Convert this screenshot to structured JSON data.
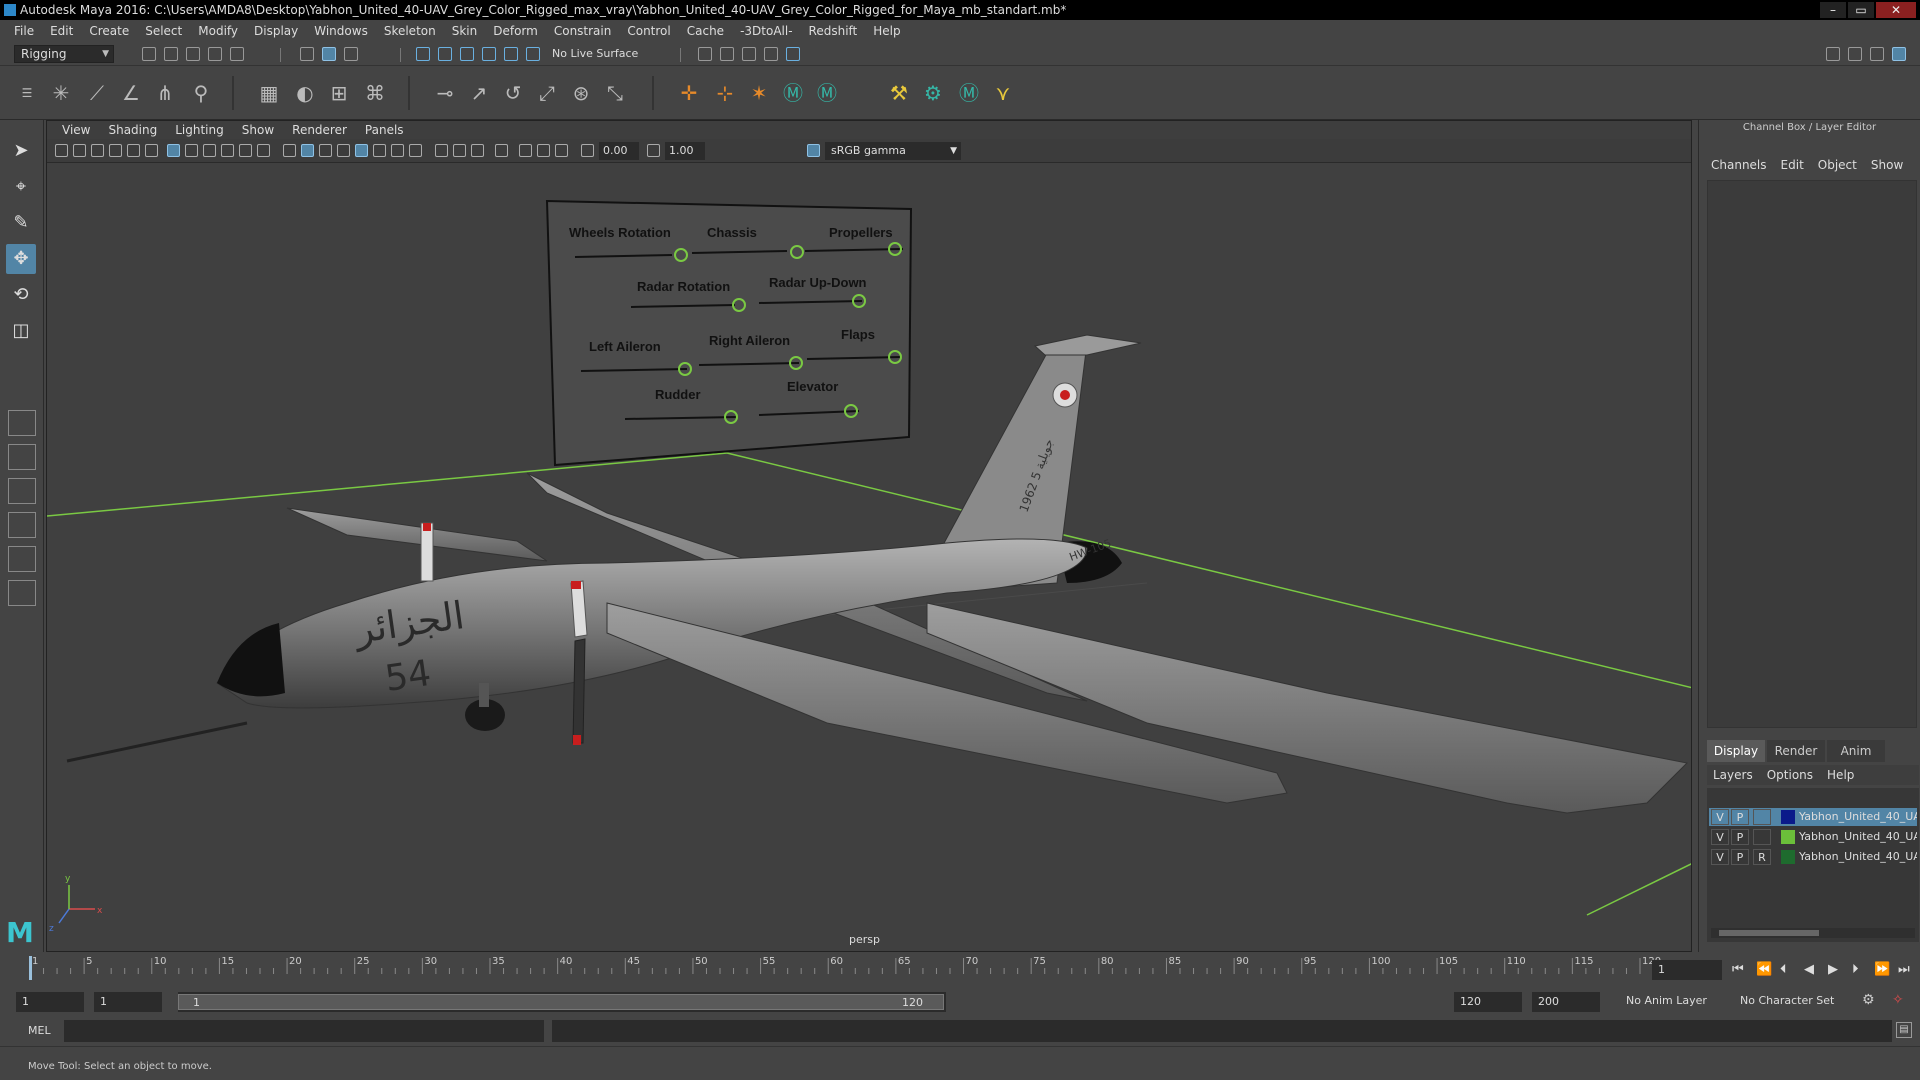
{
  "window": {
    "title": "Autodesk Maya 2016: C:\\Users\\AMDA8\\Desktop\\Yabhon_United_40-UAV_Grey_Color_Rigged_max_vray\\Yabhon_United_40-UAV_Grey_Color_Rigged_for_Maya_mb_standart.mb*"
  },
  "menubar": [
    "File",
    "Edit",
    "Create",
    "Select",
    "Modify",
    "Display",
    "Windows",
    "Skeleton",
    "Skin",
    "Deform",
    "Constrain",
    "Control",
    "Cache",
    "-3DtoAll-",
    "Redshift",
    "Help"
  ],
  "statusline": {
    "mode": "Rigging",
    "live_surface": "No Live Surface"
  },
  "panel": {
    "menu": [
      "View",
      "Shading",
      "Lighting",
      "Show",
      "Renderer",
      "Panels"
    ],
    "exposure": "0.00",
    "gamma": "1.00",
    "color_space": "sRGB gamma",
    "camera_label": "persp"
  },
  "rig_panel": {
    "labels": [
      "Wheels Rotation",
      "Chassis",
      "Propellers",
      "Radar Rotation",
      "Radar Up-Down",
      "Left Aileron",
      "Right Aileron",
      "Flaps",
      "Rudder",
      "Elevator"
    ]
  },
  "aircraft": {
    "arabic_text": "الجزائر",
    "number": "54",
    "tail_text": "1962 5 جويلية",
    "code": "HW-105"
  },
  "axis": {
    "x": "x",
    "y": "y",
    "z": "z"
  },
  "channelbox": {
    "title": "Channel Box / Layer Editor",
    "menu": [
      "Channels",
      "Edit",
      "Object",
      "Show"
    ]
  },
  "layer_editor": {
    "tabs": [
      "Display",
      "Render",
      "Anim"
    ],
    "menu": [
      "Layers",
      "Options",
      "Help"
    ],
    "layers": [
      {
        "v": "V",
        "p": "P",
        "r": "",
        "color": "#0a1a8a",
        "name": "Yabhon_United_40_UA"
      },
      {
        "v": "V",
        "p": "P",
        "r": "",
        "color": "#6bbf3a",
        "name": "Yabhon_United_40_UA"
      },
      {
        "v": "V",
        "p": "P",
        "r": "R",
        "color": "#1e6b2e",
        "name": "Yabhon_United_40_UA"
      }
    ]
  },
  "timeline": {
    "ticks": [
      "1",
      "5",
      "10",
      "15",
      "20",
      "25",
      "30",
      "35",
      "40",
      "45",
      "50",
      "55",
      "60",
      "65",
      "70",
      "75",
      "80",
      "85",
      "90",
      "95",
      "100",
      "105",
      "110",
      "115",
      "120"
    ],
    "current_frame": "1"
  },
  "range": {
    "start": "1",
    "playback_start": "1",
    "slider_start": "1",
    "slider_end": "120",
    "playback_end": "120",
    "end": "200",
    "anim_layer": "No Anim Layer",
    "char_set": "No Character Set"
  },
  "cmdline": {
    "label": "MEL"
  },
  "helpline": {
    "text": "Move Tool: Select an object to move."
  },
  "colors": {
    "accent": "#5285a6",
    "grid_line": "#7ac943",
    "maya_teal": "#3cc5cf"
  }
}
